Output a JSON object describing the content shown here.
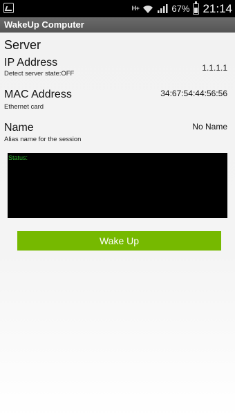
{
  "status_bar": {
    "network_type": "H+",
    "battery_percent": "67%",
    "time": "21:14",
    "icons": [
      "gallery-icon",
      "data-hsplus-icon",
      "wifi-icon",
      "signal-icon",
      "battery-icon"
    ]
  },
  "app": {
    "title": "WakeUp Computer"
  },
  "main": {
    "section_title": "Server",
    "ip": {
      "label": "IP Address",
      "subtitle": "Detect server state:OFF",
      "value": "1.1.1.1"
    },
    "mac": {
      "label": "MAC Address",
      "subtitle": "Ethernet card",
      "value": "34:67:54:44:56:56"
    },
    "name": {
      "label": "Name",
      "subtitle": "Alias name for the session",
      "value": "No Name"
    },
    "status_log": {
      "label": "Status:"
    },
    "wake_button_label": "Wake Up"
  },
  "colors": {
    "accent": "#76b900",
    "status_text": "#2fb02f",
    "action_bar": "#5f5f5f"
  }
}
